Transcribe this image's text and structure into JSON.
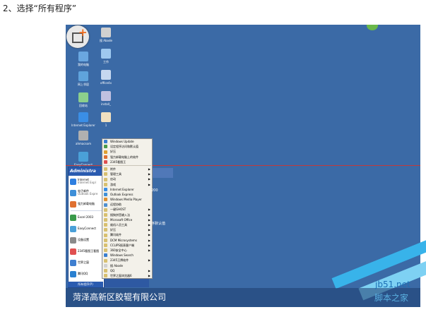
{
  "step_title": "2、选择“所有程序”",
  "desktop_icons": [
    {
      "label": "我的电脑",
      "color": "#6aa7e0"
    },
    {
      "label": "网上邻居",
      "color": "#5fa3dc"
    },
    {
      "label": "回收站",
      "color": "#8ccf8c"
    },
    {
      "label": "Internet Explorer",
      "color": "#3a8ee6"
    },
    {
      "label": "ahmacsom",
      "color": "#b0b0b0"
    },
    {
      "label": "EasyConnect",
      "color": "#4aa0d8"
    },
    {
      "label": "搜 Abode",
      "color": "#d0d0d0"
    },
    {
      "label": "工作",
      "color": "#9ec8ef"
    },
    {
      "label": "office4x",
      "color": "#c6d8f0"
    },
    {
      "label": "install_",
      "color": "#c0c0e0"
    },
    {
      "label": "1",
      "color": "#f0e0c0"
    }
  ],
  "start_menu": {
    "header": "Administra",
    "items": [
      {
        "title": "Internet",
        "sub": "Internet Expl",
        "color": "#2f7fe0"
      },
      {
        "title": "电子邮件",
        "sub": "Outlook Expre",
        "color": "#3e8fd8"
      },
      {
        "title": "强力卸载电脑",
        "sub": "",
        "color": "#e07030"
      },
      {
        "title": "Excel 2003",
        "sub": "",
        "color": "#3a9a4a"
      },
      {
        "title": "EasyConnect",
        "sub": "",
        "color": "#4aa0d8"
      },
      {
        "title": "设备设置",
        "sub": "",
        "color": "#8a8a8a"
      },
      {
        "title": "2345看图王看图",
        "sub": "",
        "color": "#e05050"
      },
      {
        "title": "世界之窗",
        "sub": "",
        "color": "#3f7fd0"
      },
      {
        "title": "腾讯QQ",
        "sub": "",
        "color": "#2a80d0"
      }
    ],
    "all_programs": "所有程序(P)"
  },
  "programs_submenu": [
    {
      "label": "Windows Update",
      "arrow": false,
      "color": "#3a7fd0"
    },
    {
      "label": "设定程序访问和默认值",
      "arrow": false,
      "color": "#4a9a4a"
    },
    {
      "label": "好压",
      "arrow": false,
      "color": "#e0a030"
    },
    {
      "label": "强力卸载电脑上的软件",
      "arrow": false,
      "color": "#e07030"
    },
    {
      "label": "2345看图王",
      "arrow": false,
      "color": "#e05050"
    },
    {
      "sep": true
    },
    {
      "label": "附件",
      "arrow": true,
      "color": "#d8c070"
    },
    {
      "label": "管理工具",
      "arrow": true,
      "color": "#d8c070"
    },
    {
      "label": "启动",
      "arrow": true,
      "color": "#d8c070"
    },
    {
      "label": "游戏",
      "arrow": true,
      "color": "#d8c070"
    },
    {
      "label": "Internet Explorer",
      "arrow": false,
      "color": "#3a8ee6"
    },
    {
      "label": "Outlook Express",
      "arrow": false,
      "color": "#3e8fd8"
    },
    {
      "label": "Windows Media Player",
      "arrow": false,
      "color": "#e09030"
    },
    {
      "label": "远程协助",
      "arrow": false,
      "color": "#5090d0"
    },
    {
      "label": "一键GHOST",
      "arrow": true,
      "color": "#d8c070"
    },
    {
      "label": "搜狗拼音输入法",
      "arrow": true,
      "color": "#d8c070"
    },
    {
      "label": "Microsoft Office",
      "arrow": true,
      "color": "#d8c070"
    },
    {
      "label": "维机人员工具",
      "arrow": true,
      "color": "#d8c070"
    },
    {
      "label": "好压",
      "arrow": true,
      "color": "#d8c070"
    },
    {
      "label": "腾讯软件",
      "arrow": true,
      "color": "#d8c070"
    },
    {
      "label": "DCM Microsystems",
      "arrow": true,
      "color": "#d8c070"
    },
    {
      "label": "CCLIPS报表客户端",
      "arrow": true,
      "color": "#d8c070"
    },
    {
      "label": "360安全中心",
      "arrow": true,
      "color": "#d8c070"
    },
    {
      "label": "Windows Search",
      "arrow": false,
      "color": "#3a7fd0"
    },
    {
      "label": "2345王牌软件",
      "arrow": true,
      "color": "#d8c070"
    },
    {
      "label": "搜 Abode",
      "arrow": false,
      "color": "#d0d0d0"
    },
    {
      "label": "QQ",
      "arrow": true,
      "color": "#d8c070"
    },
    {
      "label": "世界之窗浏览器6",
      "arrow": true,
      "color": "#d8c070"
    }
  ],
  "partial_texts": [
    "200",
    "序默认值"
  ],
  "caption": "菏泽高新区胶辊有限公司",
  "watermark": {
    "line1": "jb51.net",
    "line2": "脚本之家"
  }
}
